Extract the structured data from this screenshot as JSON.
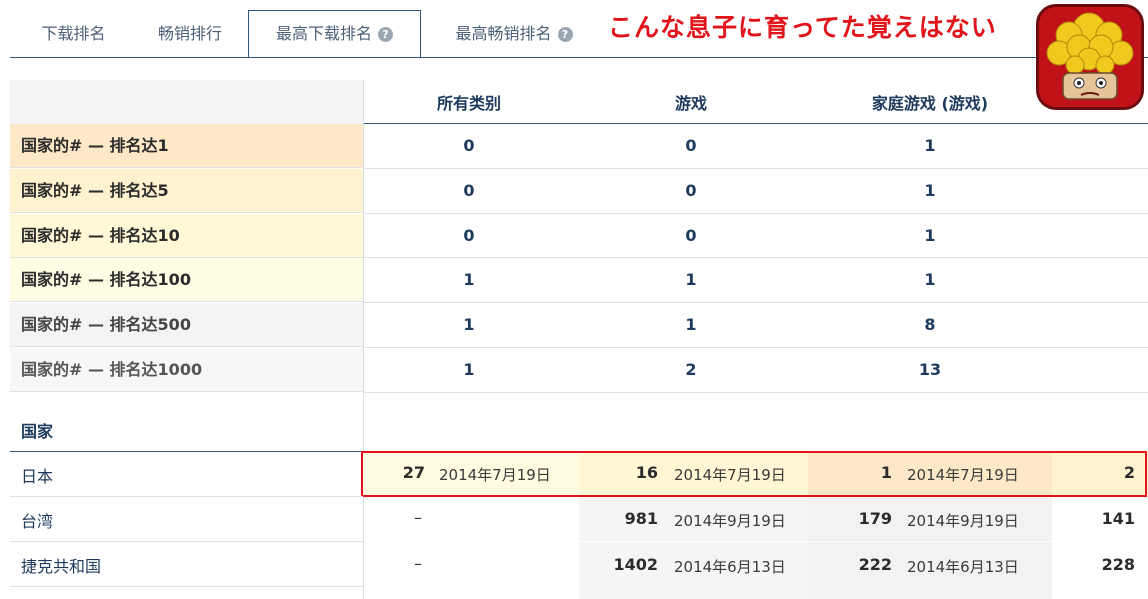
{
  "tabs": [
    {
      "label": "下载排名",
      "active": false,
      "help": false
    },
    {
      "label": "畅销排行",
      "active": false,
      "help": false
    },
    {
      "label": "最高下载排名",
      "active": true,
      "help": true
    },
    {
      "label": "最高畅销排名",
      "active": false,
      "help": true
    }
  ],
  "caption": "こんな息子に育ってた覚えはない",
  "columns": [
    "所有类别",
    "游戏",
    "家庭游戏 (游戏)"
  ],
  "rank_rows": [
    {
      "label": "国家的# — 排名达1",
      "values": [
        "0",
        "0",
        "1"
      ]
    },
    {
      "label": "国家的# — 排名达5",
      "values": [
        "0",
        "0",
        "1"
      ]
    },
    {
      "label": "国家的# — 排名达10",
      "values": [
        "0",
        "0",
        "1"
      ]
    },
    {
      "label": "国家的# — 排名达100",
      "values": [
        "1",
        "1",
        "1"
      ]
    },
    {
      "label": "国家的# — 排名达500",
      "values": [
        "1",
        "1",
        "8"
      ]
    },
    {
      "label": "国家的# — 排名达1000",
      "values": [
        "1",
        "2",
        "13"
      ]
    }
  ],
  "country_section_title": "国家",
  "countries": [
    {
      "name": "日本",
      "cells": [
        {
          "rank": "27",
          "date": "2014年7月19日"
        },
        {
          "rank": "16",
          "date": "2014年7月19日"
        },
        {
          "rank": "1",
          "date": "2014年7月19日"
        },
        {
          "rank": "2",
          "date": ""
        }
      ]
    },
    {
      "name": "台湾",
      "cells": [
        {
          "rank": "–",
          "date": ""
        },
        {
          "rank": "981",
          "date": "2014年9月19日"
        },
        {
          "rank": "179",
          "date": "2014年9月19日"
        },
        {
          "rank": "141",
          "date": ""
        }
      ]
    },
    {
      "name": "捷克共和国",
      "cells": [
        {
          "rank": "–",
          "date": ""
        },
        {
          "rank": "1402",
          "date": "2014年6月13日"
        },
        {
          "rank": "222",
          "date": "2014年6月13日"
        },
        {
          "rank": "228",
          "date": ""
        }
      ]
    }
  ],
  "colors": {
    "accent": "#2e5580",
    "highlight_border": "#e0141a",
    "caption": "#e0141a"
  },
  "icons": {
    "help": "question-circle-icon",
    "app": "app-icon-lion-face"
  }
}
